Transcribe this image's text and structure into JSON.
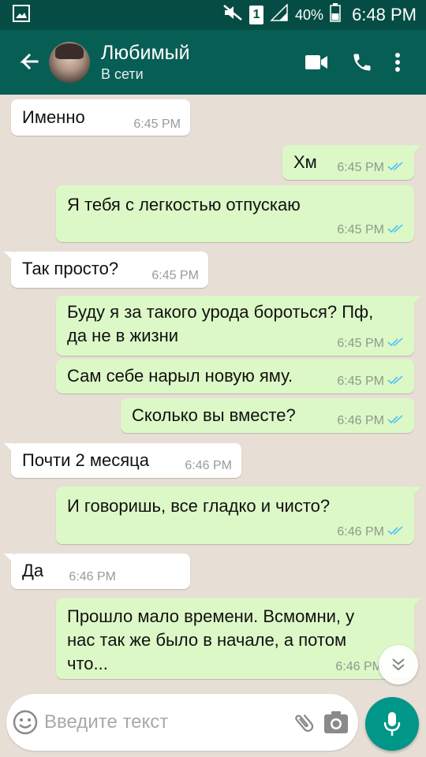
{
  "status_bar": {
    "sim": "1",
    "battery": "40%",
    "time": "6:48 PM"
  },
  "header": {
    "contact_name": "Любимый",
    "contact_status": "В сети"
  },
  "messages": [
    {
      "dir": "in",
      "text": "Именно",
      "time": "6:45 PM"
    },
    {
      "dir": "out",
      "text": "Хм",
      "time": "6:45 PM",
      "read": true
    },
    {
      "dir": "out",
      "text": "Я тебя с легкостью отпускаю",
      "time": "6:45 PM",
      "read": true
    },
    {
      "dir": "in",
      "text": "Так просто?",
      "time": "6:45 PM"
    },
    {
      "dir": "out",
      "text_lines": [
        "Буду я за такого урода бороться? Пф,",
        "да не в жизни"
      ],
      "time": "6:45 PM",
      "read": true
    },
    {
      "dir": "out",
      "text": "Сам себе нарыл новую яму.",
      "time": "6:45 PM",
      "read": true
    },
    {
      "dir": "out",
      "text": "Сколько вы вместе?",
      "time": "6:46 PM",
      "read": true
    },
    {
      "dir": "in",
      "text": "Почти 2 месяца",
      "time": "6:46 PM"
    },
    {
      "dir": "out",
      "text": "И говоришь, все гладко и чисто?",
      "time": "6:46 PM",
      "read": true
    },
    {
      "dir": "in",
      "text": "Да",
      "time": "6:46 PM"
    },
    {
      "dir": "out",
      "text_lines": [
        "Прошло мало времени. Всмомни, у",
        "нас так же было в начале, а потом",
        "что..."
      ],
      "time": "6:46 PM",
      "read": true
    }
  ],
  "input": {
    "placeholder": "Введите текст",
    "value": ""
  },
  "colors": {
    "header": "#075e54",
    "status_bar": "#054d44",
    "outgoing_bubble": "#dcf8c6",
    "incoming_bubble": "#ffffff",
    "read_ticks": "#4fc3f7",
    "mic_button": "#009688"
  },
  "icons": [
    "back-arrow-icon",
    "video-call-icon",
    "phone-icon",
    "more-vert-icon",
    "emoji-icon",
    "attach-icon",
    "camera-icon",
    "mic-icon",
    "chevron-double-down-icon"
  ]
}
